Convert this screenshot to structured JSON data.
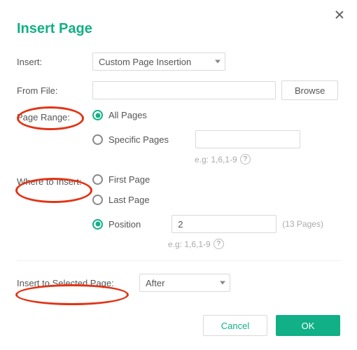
{
  "title": "Insert Page",
  "labels": {
    "insert": "Insert:",
    "from_file": "From File:",
    "page_range": "Page Range:",
    "where_to_insert": "Where to Insert:",
    "insert_to_selected": "Insert to Selected Page:"
  },
  "insert_select": {
    "value": "Custom Page Insertion"
  },
  "from_file": {
    "value": "",
    "browse_label": "Browse"
  },
  "page_range": {
    "all_pages_label": "All Pages",
    "specific_pages_label": "Specific Pages",
    "specific_value": "",
    "hint": "e.g: 1,6,1-9"
  },
  "where": {
    "first_page_label": "First Page",
    "last_page_label": "Last Page",
    "position_label": "Position",
    "position_value": "2",
    "page_count": "(13 Pages)",
    "hint": "e.g: 1,6,1-9"
  },
  "insert_selected": {
    "value": "After"
  },
  "buttons": {
    "cancel": "Cancel",
    "ok": "OK"
  }
}
